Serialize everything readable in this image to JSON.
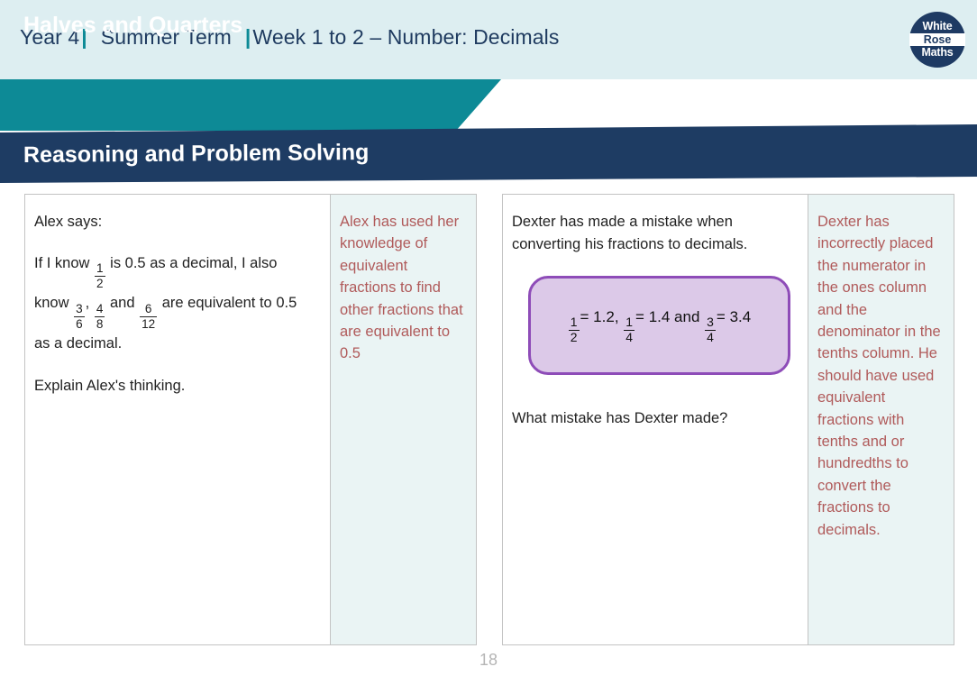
{
  "header": {
    "year": "Year 4",
    "term": "Summer Term",
    "week": "Week 1 to 2 – Number: Decimals",
    "separator": "|",
    "logo": {
      "line1": "White",
      "line2": "Rose",
      "line3": "Maths"
    }
  },
  "banners": {
    "topic": "Halves and Quarters",
    "section": "Reasoning and Problem Solving"
  },
  "questions": [
    {
      "id": "question-1",
      "intro": "Alex says:",
      "body_line_1_a": "If I know",
      "body_line_1_frac": {
        "num": "1",
        "den": "2"
      },
      "body_line_1_b": "is 0.5 as a decimal, I also",
      "body_line_2_a": "know",
      "body_line_2_frac_1": {
        "num": "3",
        "den": "6"
      },
      "body_line_2_comma": ",",
      "body_line_2_frac_2": {
        "num": "4",
        "den": "8"
      },
      "body_line_2_b": "and",
      "body_line_2_frac_3": {
        "num": "6",
        "den": "12"
      },
      "body_line_2_c": "are equivalent to 0.5",
      "body_line_3": "as a decimal.",
      "prompt": "Explain Alex's thinking.",
      "answer": "Alex has used her knowledge of equivalent fractions to find other fractions that are equivalent to 0.5"
    },
    {
      "id": "question-2",
      "intro_line_1": "Dexter has made a mistake when",
      "intro_line_2": "converting his fractions to decimals.",
      "speech": {
        "frac_1": {
          "num": "1",
          "den": "2"
        },
        "eq_1": "= 1.2,",
        "frac_2": {
          "num": "1",
          "den": "4"
        },
        "eq_2": "= 1.4 and",
        "frac_3": {
          "num": "3",
          "den": "4"
        },
        "eq_3": "= 3.4"
      },
      "prompt": "What mistake has Dexter made?",
      "answer": "Dexter has incorrectly placed the numerator in the ones column and the denominator in the tenths column. He should have used equivalent fractions with tenths and or hundredths to convert the fractions to decimals."
    }
  ],
  "footer": {
    "page_number": "18"
  },
  "colors": {
    "header_bg": "#ddeef1",
    "teal": "#0d8a96",
    "navy": "#1e3c63",
    "answer_bg": "#eaf4f4",
    "answer_text": "#b05a5a",
    "speech_border": "#8e4cb8",
    "speech_fill": "#dcc9e8"
  }
}
